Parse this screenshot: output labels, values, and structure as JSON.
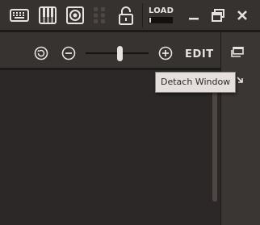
{
  "toolbar": {
    "icons": [
      "keyboard-icon",
      "piano-icon",
      "speaker-icon",
      "grid-icon",
      "unlock-icon"
    ],
    "load": {
      "label": "LOAD",
      "level": 0.05
    },
    "window_controls": [
      "minimize-icon",
      "restore-icon",
      "close-icon"
    ]
  },
  "subbar": {
    "icons": [
      "rotate-icon",
      "zoom-out-icon",
      "zoom-in-icon"
    ],
    "zoom_level": 0.55,
    "edit_label": "EDIT"
  },
  "side_panel": {
    "detach_icon": "detach-window-icon",
    "tooltip": "Detach Window"
  },
  "colors": {
    "toolbar_bg": "#363230",
    "workspace_bg": "#2b2827",
    "foreground": "#e6e2df",
    "tooltip_bg": "#e4dfdc"
  }
}
